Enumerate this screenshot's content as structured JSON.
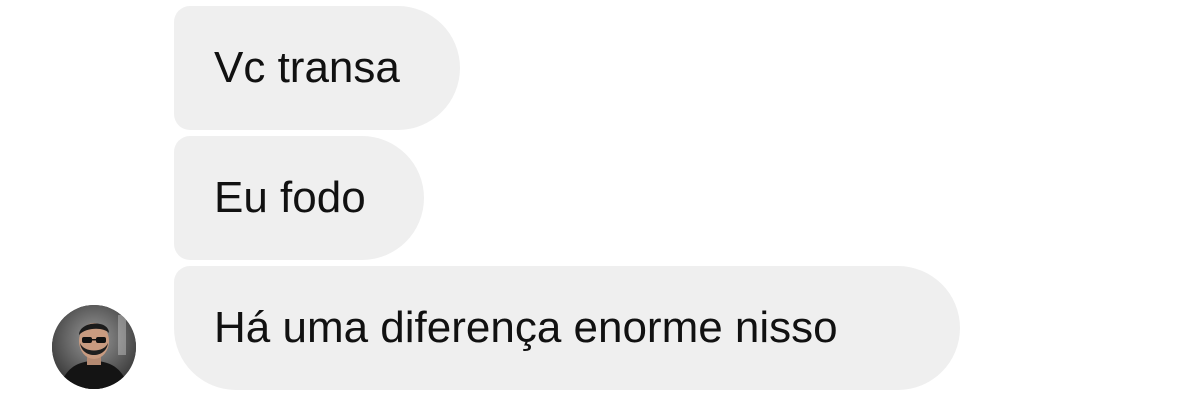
{
  "conversation": {
    "messages": [
      {
        "text": "Vc transa"
      },
      {
        "text": "Eu fodo"
      },
      {
        "text": "Há uma diferença enorme nisso"
      }
    ],
    "sender_avatar": {
      "icon": "user-photo-avatar"
    }
  },
  "colors": {
    "bubble_background": "#efefef",
    "text": "#111111",
    "page_background": "#ffffff"
  }
}
